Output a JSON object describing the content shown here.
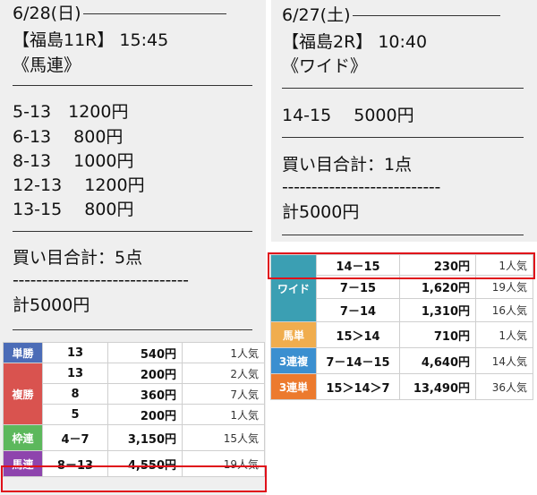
{
  "left": {
    "date": "6/28(日)",
    "race": "【福島11R】 15:45",
    "bet_type": "《馬連》",
    "bets": [
      "5-13　1200円",
      "6-13　 800円",
      "8-13　 1000円",
      "12-13　 1200円",
      "13-15　 800円"
    ],
    "total_points": "買い目合計：5点",
    "dashes": "------------------------------",
    "total_amount": "計5000円",
    "payouts": [
      {
        "label": "単勝",
        "color": "#4b6cb7",
        "rows": [
          {
            "combo": "13",
            "amount": "540円",
            "pop": "1人気"
          }
        ]
      },
      {
        "label": "複勝",
        "color": "#d9534f",
        "rows": [
          {
            "combo": "13",
            "amount": "200円",
            "pop": "2人気"
          },
          {
            "combo": "8",
            "amount": "360円",
            "pop": "7人気"
          },
          {
            "combo": "5",
            "amount": "200円",
            "pop": "1人気"
          }
        ]
      },
      {
        "label": "枠連",
        "color": "#5cb85c",
        "rows": [
          {
            "combo": "4－7",
            "amount": "3,150円",
            "pop": "15人気"
          }
        ]
      },
      {
        "label": "馬連",
        "color": "#8e44ad",
        "rows": [
          {
            "combo": "8－13",
            "amount": "4,550円",
            "pop": "19人気"
          }
        ]
      }
    ]
  },
  "right": {
    "date": "6/27(土)",
    "race": "【福島2R】 10:40",
    "bet_type": "《ワイド》",
    "bets": [
      "14-15　 5000円"
    ],
    "total_points": "買い目合計：1点",
    "dashes": "---------------------------",
    "total_amount": "計5000円",
    "payouts": [
      {
        "label": "ワイド",
        "color": "#3b9fb3",
        "rows": [
          {
            "combo": "14－15",
            "amount": "230円",
            "pop": "1人気"
          },
          {
            "combo": "7－15",
            "amount": "1,620円",
            "pop": "19人気"
          },
          {
            "combo": "7－14",
            "amount": "1,310円",
            "pop": "16人気"
          }
        ]
      },
      {
        "label": "馬単",
        "color": "#f0ad4e",
        "rows": [
          {
            "combo": "15＞14",
            "amount": "710円",
            "pop": "1人気"
          }
        ]
      },
      {
        "label": "3連複",
        "color": "#3b8fd0",
        "rows": [
          {
            "combo": "7－14－15",
            "amount": "4,640円",
            "pop": "14人気"
          }
        ]
      },
      {
        "label": "3連単",
        "color": "#ec7a2e",
        "rows": [
          {
            "combo": "15＞14＞7",
            "amount": "13,490円",
            "pop": "36人気"
          }
        ]
      }
    ]
  }
}
